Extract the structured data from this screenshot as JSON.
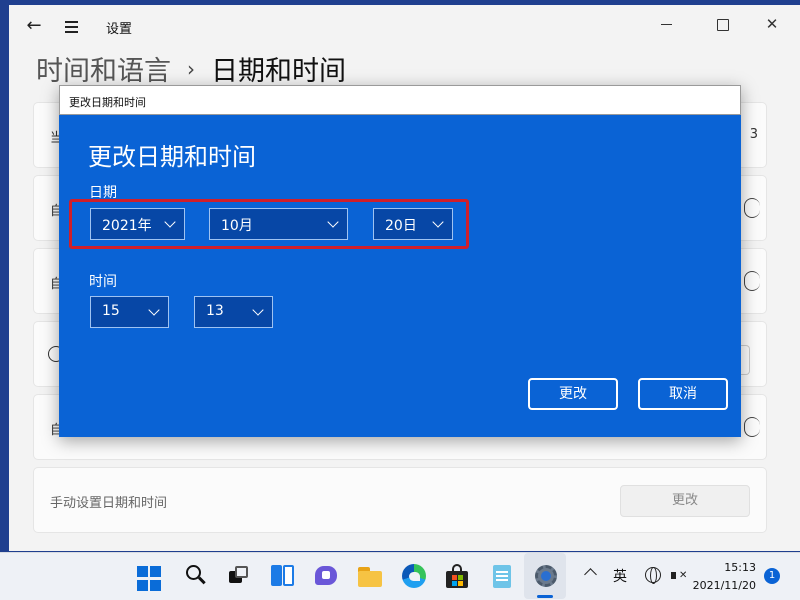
{
  "settings": {
    "title": "设置",
    "breadcrumb_parent": "时间和语言",
    "breadcrumb_separator": "›",
    "breadcrumb_current": "日期和时间",
    "cards": [
      {
        "label_partial": "当",
        "trailing": "3"
      },
      {
        "label_partial": "自"
      },
      {
        "label_partial": "自"
      },
      {
        "label_partial": ""
      },
      {
        "label_partial": "自"
      },
      {
        "label": "手动设置日期和时间",
        "button": "更改"
      }
    ]
  },
  "dialog": {
    "window_title": "更改日期和时间",
    "heading": "更改日期和时间",
    "date_label": "日期",
    "year": "2021年",
    "month": "10月",
    "day": "20日",
    "time_label": "时间",
    "hour": "15",
    "minute": "13",
    "change_button": "更改",
    "cancel_button": "取消",
    "accent_color": "#0a63d5",
    "highlight_color": "#d01f2a"
  },
  "taskbar": {
    "icons": [
      "start-icon",
      "search-icon",
      "task-view-icon",
      "widgets-icon",
      "chat-icon",
      "file-explorer-icon",
      "edge-icon",
      "store-icon",
      "notepad-icon",
      "settings-icon"
    ],
    "ime": "英",
    "time": "15:13",
    "date": "2021/11/20",
    "notification_count": "1"
  }
}
